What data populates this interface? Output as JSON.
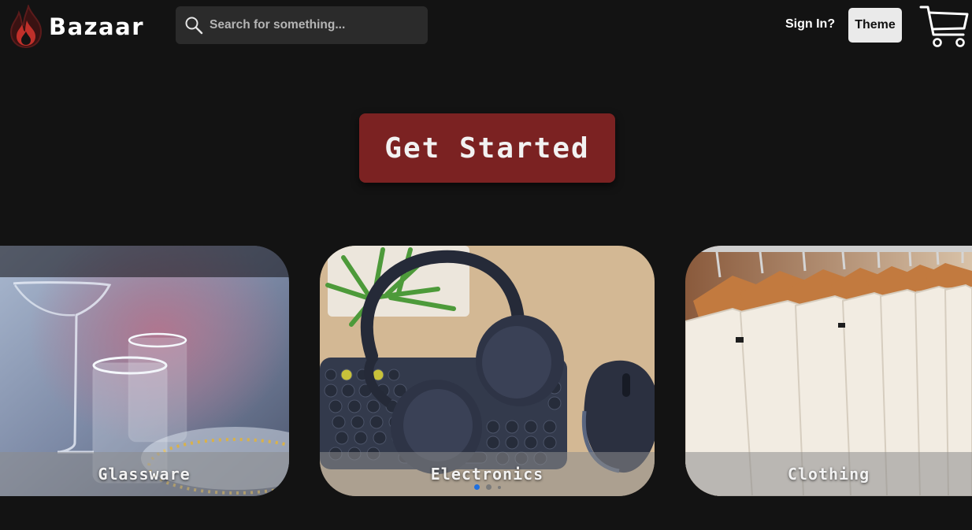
{
  "header": {
    "brand": "Bazaar",
    "logo_icon": "flame-logo-icon",
    "search": {
      "placeholder": "Search for something...",
      "value": "",
      "icon": "search-icon"
    },
    "signin_label": "Sign In?",
    "theme_label": "Theme",
    "cart_icon": "cart-icon"
  },
  "hero": {
    "cta_label": "Get Started",
    "cta_color": "#7b2222"
  },
  "carousel": {
    "cards": [
      {
        "label": "Glassware"
      },
      {
        "label": "Electronics"
      },
      {
        "label": "Clothing"
      }
    ],
    "active_index": 1,
    "indicator_count": 3
  },
  "colors": {
    "background": "#131313",
    "accent": "#7b2222",
    "active_dot": "#1e6fe0"
  }
}
